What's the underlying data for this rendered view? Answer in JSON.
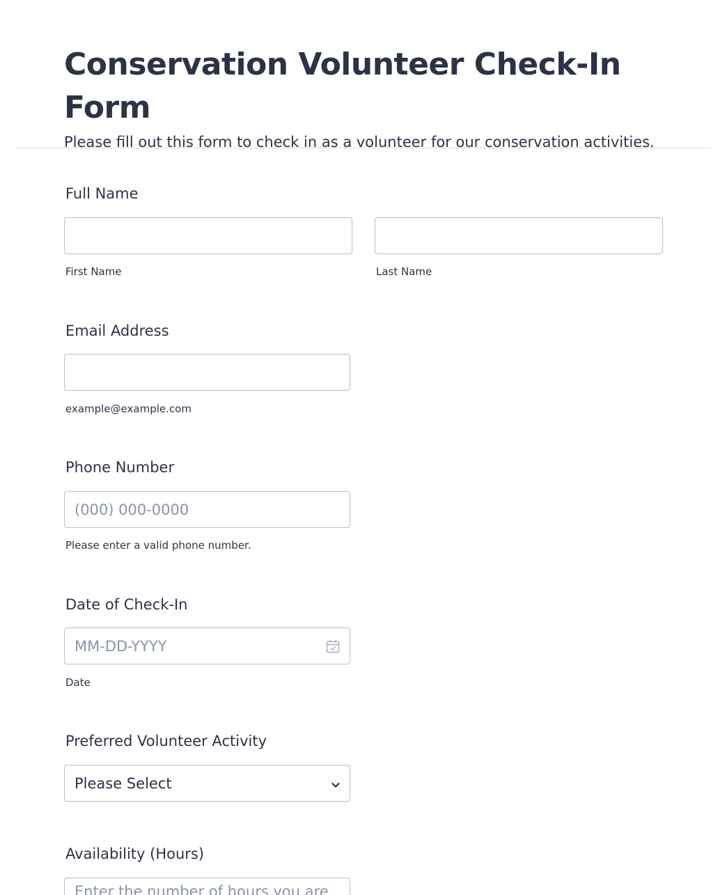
{
  "header": {
    "title": "Conservation Volunteer Check-In Form",
    "subtitle": "Please fill out this form to check in as a volunteer for our conservation activities."
  },
  "full_name": {
    "label": "Full Name",
    "first_value": "",
    "first_sublabel": "First Name",
    "last_value": "",
    "last_sublabel": "Last Name"
  },
  "email": {
    "label": "Email Address",
    "value": "",
    "sublabel": "example@example.com"
  },
  "phone": {
    "label": "Phone Number",
    "placeholder": "(000) 000-0000",
    "sublabel": "Please enter a valid phone number."
  },
  "date": {
    "label": "Date of Check-In",
    "placeholder": "MM-DD-YYYY",
    "sublabel": "Date",
    "icon": "calendar-icon"
  },
  "activity": {
    "label": "Preferred Volunteer Activity",
    "selected": "Please Select",
    "icon": "chevron-down-icon"
  },
  "availability": {
    "label": "Availability (Hours)",
    "placeholder": "Enter the number of hours you are available"
  },
  "colors": {
    "text": "#2c3345",
    "border": "#b8bdc9",
    "placeholder": "#8894ab",
    "divider": "#d8dae9"
  }
}
